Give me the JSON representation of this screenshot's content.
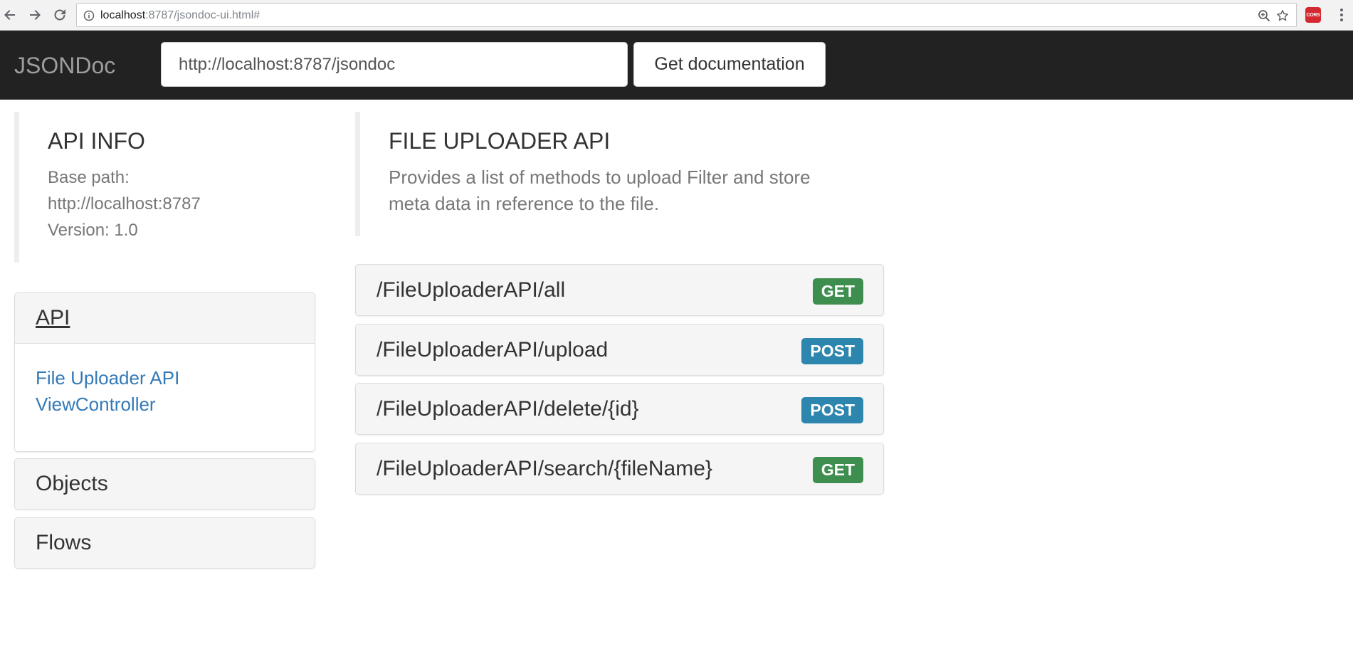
{
  "browser": {
    "url_host": "localhost",
    "url_rest": ":8787/jsondoc-ui.html#",
    "extension_label": "CORS"
  },
  "navbar": {
    "brand": "JSONDoc",
    "url_value": "http://localhost:8787/jsondoc",
    "get_doc_label": "Get documentation"
  },
  "api_info": {
    "title": "API INFO",
    "base_path_label": "Base path:",
    "base_path_value": "http://localhost:8787",
    "version": "Version: 1.0"
  },
  "sidebar": {
    "api_heading": "API",
    "api_links": [
      "File Uploader API",
      "ViewController"
    ],
    "objects_heading": "Objects",
    "flows_heading": "Flows"
  },
  "api": {
    "title": "FILE UPLOADER API",
    "description": "Provides a list of methods to upload Filter and store meta data in reference to the file."
  },
  "methods": [
    {
      "path": "/FileUploaderAPI/all",
      "verb": "GET"
    },
    {
      "path": "/FileUploaderAPI/upload",
      "verb": "POST"
    },
    {
      "path": "/FileUploaderAPI/delete/{id}",
      "verb": "POST"
    },
    {
      "path": "/FileUploaderAPI/search/{fileName}",
      "verb": "GET"
    }
  ],
  "colors": {
    "navbar_bg": "#222222",
    "get_badge": "#3e8f4f",
    "post_badge": "#2d86ad",
    "link": "#337ab7"
  }
}
